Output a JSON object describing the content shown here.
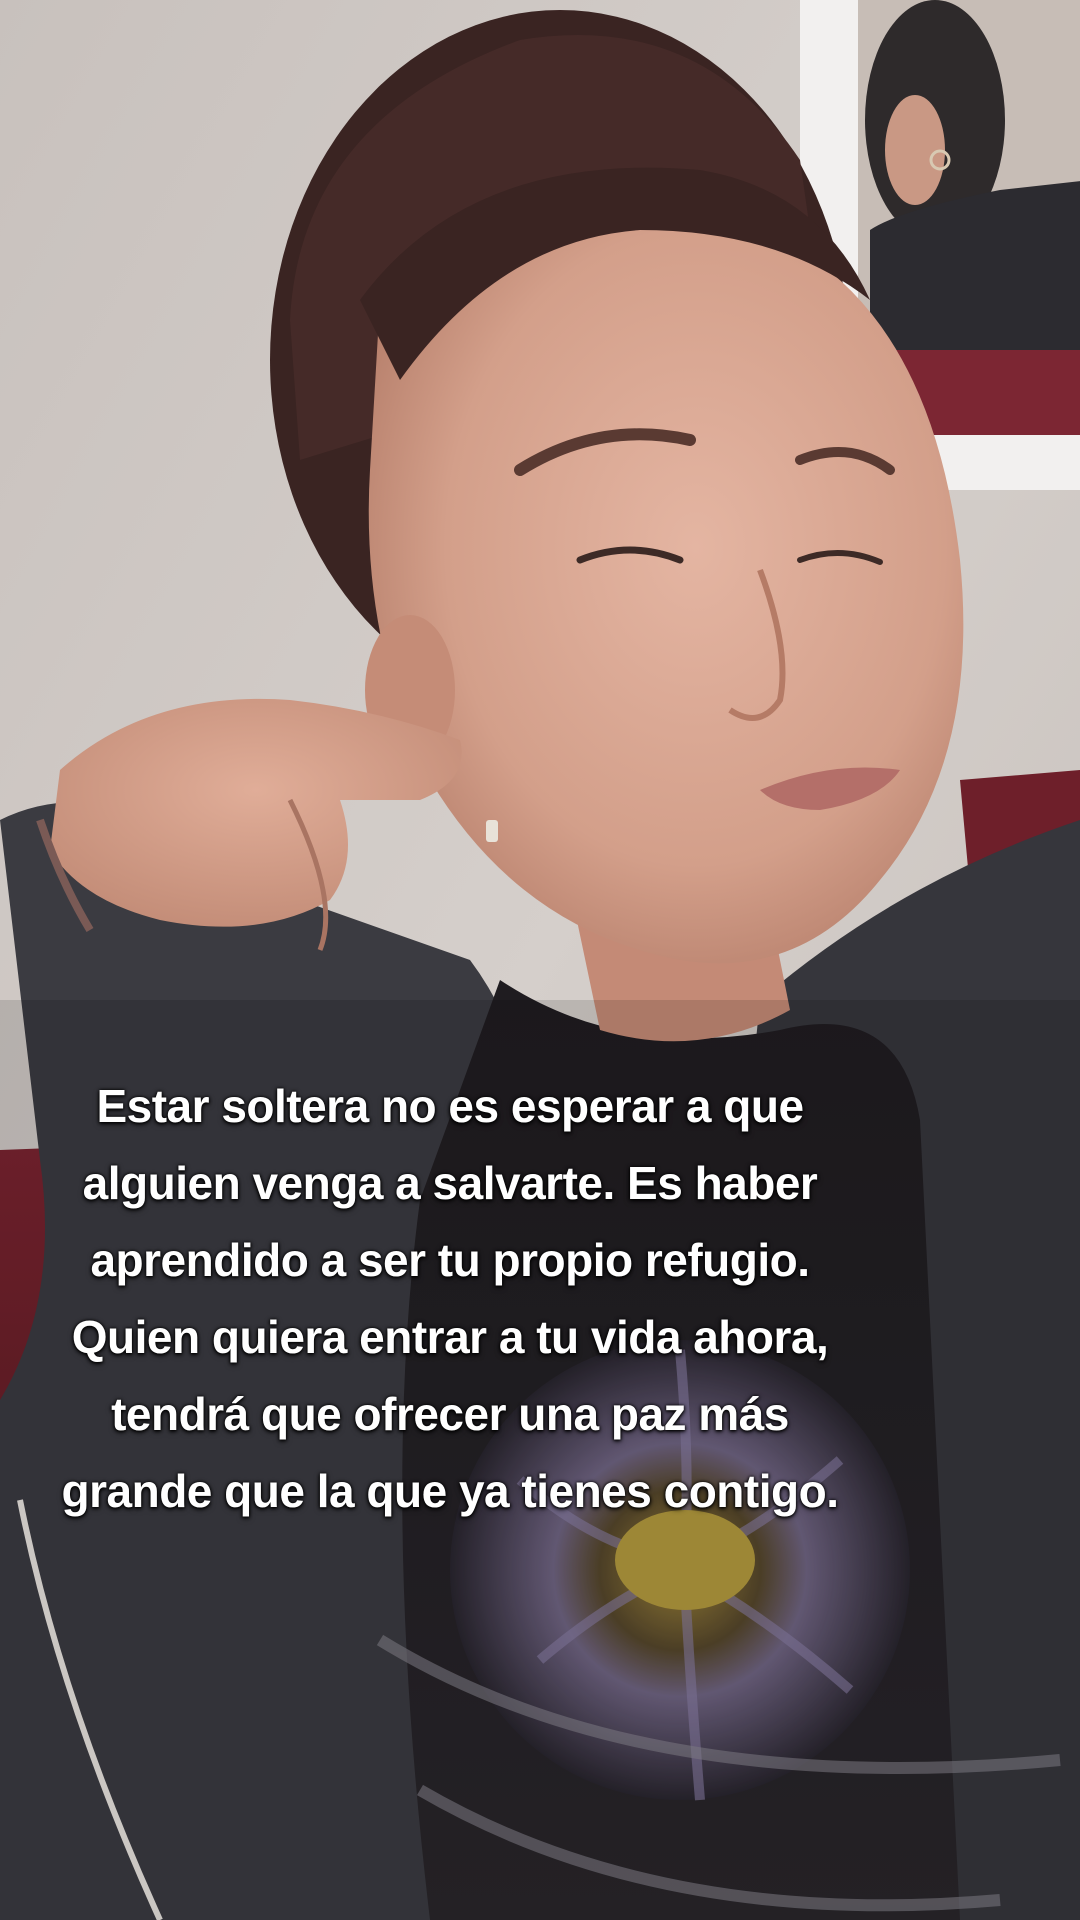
{
  "caption": {
    "lines": [
      "Estar soltera no es esperar a que",
      "alguien venga a salvarte. Es haber",
      "aprendido a ser tu propio refugio.",
      "Quien quiera entrar a tu vida ahora,",
      "tendrá que ofrecer una paz más",
      "grande que la que ya tienes contigo."
    ]
  },
  "scene": {
    "subject": "woman-selfie",
    "colors": {
      "wall": "#d2cbc7",
      "hair": "#3a2422",
      "skin": "#d9a893",
      "jacket": "#3a3a3f",
      "shirt": "#1c1a1d",
      "sofa": "#6e1f2a",
      "mirror_frame": "#f1efee",
      "caption_text": "#ffffff"
    }
  }
}
